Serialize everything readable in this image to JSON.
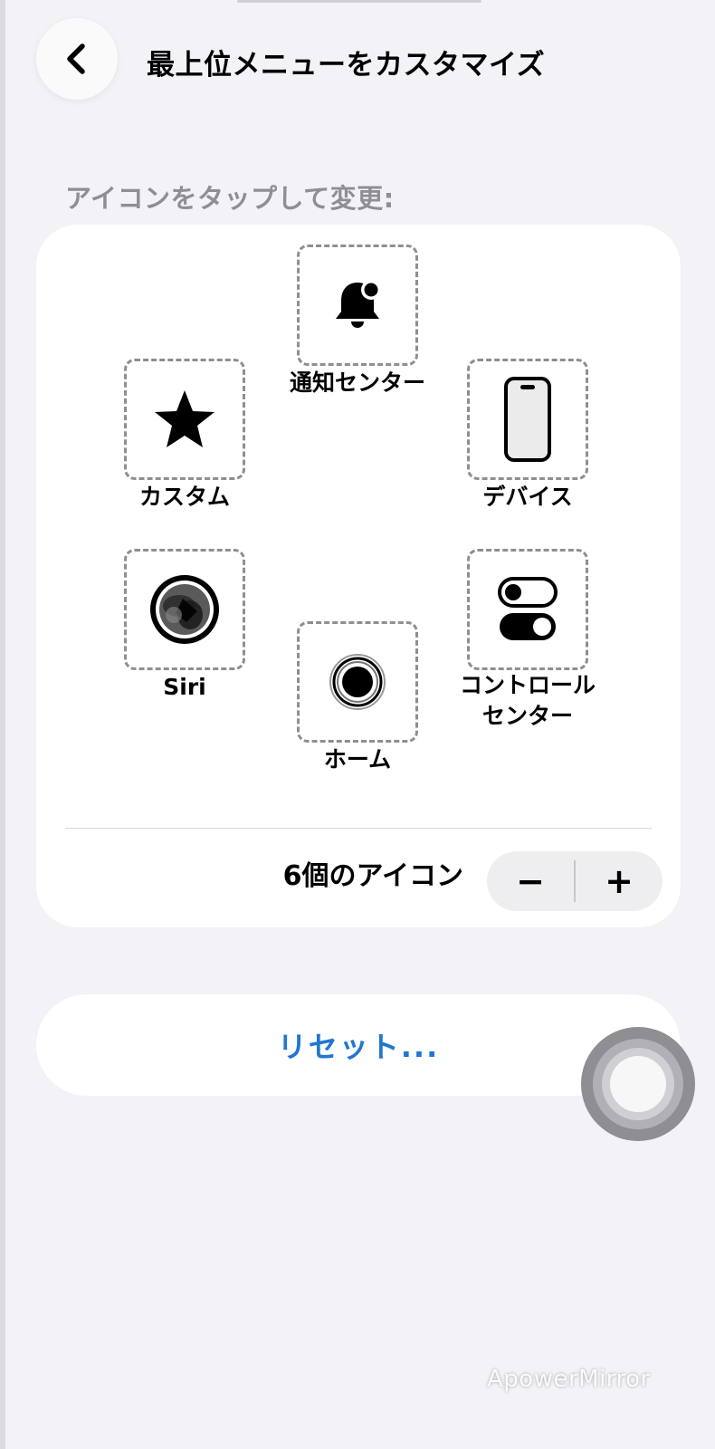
{
  "header": {
    "title": "最上位メニューをカスタマイズ",
    "back_icon": "chevron-left-icon"
  },
  "section_header": "アイコンをタップして変更:",
  "icons": [
    {
      "label": "通知センター",
      "icon": "bell-badge-icon"
    },
    {
      "label": "カスタム",
      "icon": "star-icon"
    },
    {
      "label": "デバイス",
      "icon": "iphone-icon"
    },
    {
      "label": "Siri",
      "icon": "siri-icon"
    },
    {
      "label": "コントロール\nセンター",
      "icon": "toggles-icon"
    },
    {
      "label": "ホーム",
      "icon": "home-circle-icon"
    }
  ],
  "count_label": "6個のアイコン",
  "stepper": {
    "minus": "−",
    "plus": "+"
  },
  "reset_label": "リセット...",
  "watermark": "ApowerMirror",
  "colors": {
    "background": "#f2f2f7",
    "card": "#ffffff",
    "accent": "#2176d2",
    "secondary_text": "#8e8e93"
  }
}
